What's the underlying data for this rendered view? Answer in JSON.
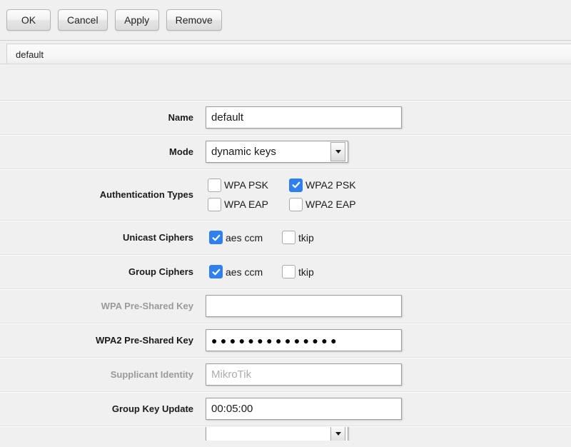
{
  "toolbar": {
    "buttons": [
      {
        "label": "OK",
        "name": "ok-button"
      },
      {
        "label": "Cancel",
        "name": "cancel-button"
      },
      {
        "label": "Apply",
        "name": "apply-button"
      },
      {
        "label": "Remove",
        "name": "remove-button"
      }
    ]
  },
  "tab": {
    "label": "default"
  },
  "form": {
    "name": {
      "label": "Name",
      "value": "default"
    },
    "mode": {
      "label": "Mode",
      "value": "dynamic keys",
      "arrow_icon": "chevron-down-icon"
    },
    "authentication_types": {
      "label": "Authentication Types",
      "options": [
        {
          "label": "WPA PSK",
          "checked": false
        },
        {
          "label": "WPA2 PSK",
          "checked": true
        },
        {
          "label": "WPA EAP",
          "checked": false
        },
        {
          "label": "WPA2 EAP",
          "checked": false
        }
      ]
    },
    "unicast_ciphers": {
      "label": "Unicast Ciphers",
      "options": [
        {
          "label": "aes ccm",
          "checked": true
        },
        {
          "label": "tkip",
          "checked": false
        }
      ]
    },
    "group_ciphers": {
      "label": "Group Ciphers",
      "options": [
        {
          "label": "aes ccm",
          "checked": true
        },
        {
          "label": "tkip",
          "checked": false
        }
      ]
    },
    "wpa_preshared_key": {
      "label": "WPA Pre-Shared Key",
      "value": "",
      "disabled": true
    },
    "wpa2_preshared_key": {
      "label": "WPA2 Pre-Shared Key",
      "value": "●●●●●●●●●●●●●●",
      "masked_char_count": 14
    },
    "supplicant_identity": {
      "label": "Supplicant Identity",
      "value": "MikroTik",
      "disabled": true
    },
    "group_key_update": {
      "label": "Group Key Update",
      "value": "00:05:00"
    }
  },
  "colors": {
    "window_background": "#f0f0f0",
    "checkbox_checked": "#2f80ed",
    "disabled_text": "#9a9a9a",
    "field_border": "#9a9a9a"
  }
}
